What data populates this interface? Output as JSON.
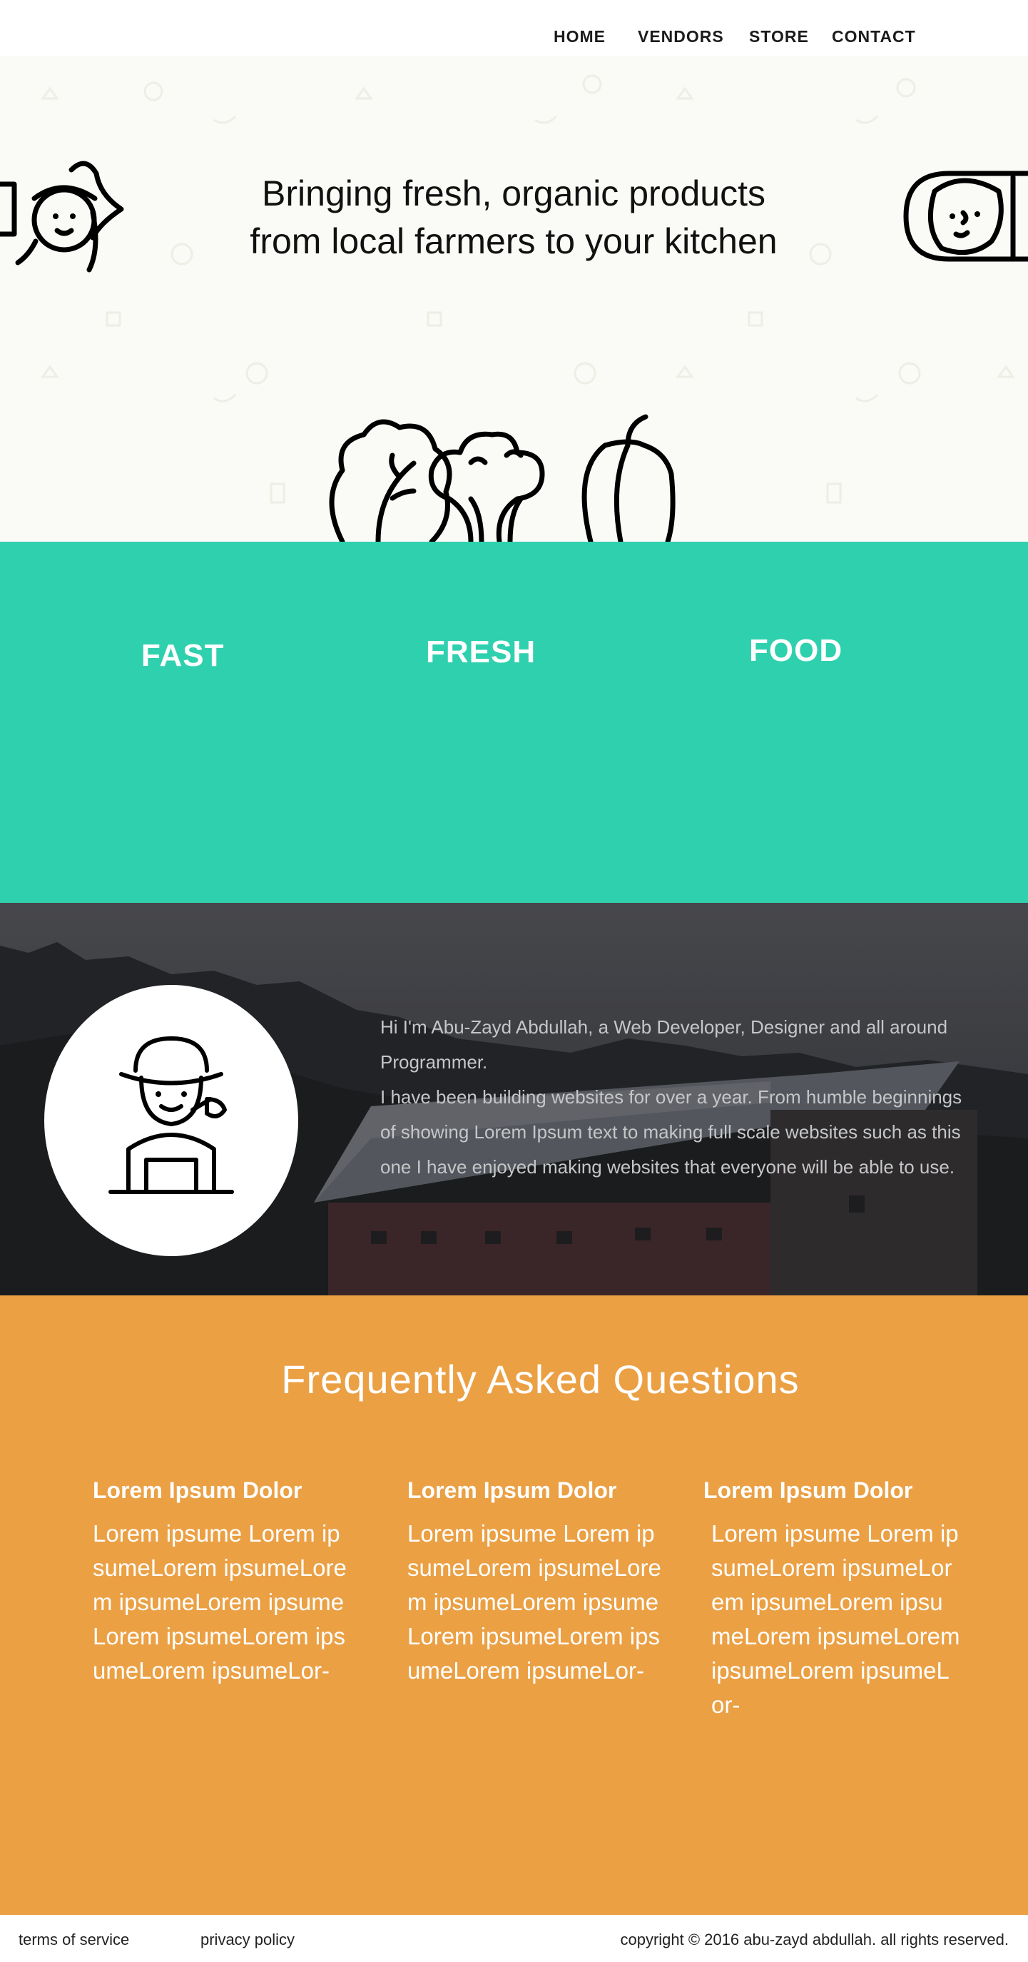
{
  "nav": {
    "items": [
      {
        "label": "HOME"
      },
      {
        "label": "VENDORS"
      },
      {
        "label": "STORE"
      },
      {
        "label": "CONTACT"
      }
    ]
  },
  "hero": {
    "title_line_1": "Bringing fresh, organic products",
    "title_line_2": "from local farmers to your kitchen",
    "icons": [
      "farmer-icon",
      "farmer-woman-icon",
      "lettuce-icon",
      "broccoli-icon",
      "pepper-icon"
    ]
  },
  "features": {
    "background_color": "#2fd0ae",
    "items": [
      {
        "label": "FAST"
      },
      {
        "label": "FRESH"
      },
      {
        "label": "FOOD"
      }
    ]
  },
  "about": {
    "avatar_icon": "farmer-icon",
    "text_line_1": "Hi I'm Abu-Zayd Abdullah, a Web Developer, Designer and all around",
    "text_line_2": "Programmer.",
    "text_line_3": "I have been building websites for over a year. From humble beginnings",
    "text_line_4": "of showing Lorem Ipsum text to making full scale websites such as this",
    "text_line_5": "one I have enjoyed making websites that everyone will be able to use."
  },
  "faq": {
    "background_color": "#eba044",
    "title": "Frequently Asked Questions",
    "items": [
      {
        "question": "Lorem Ipsum Dolor",
        "answer": "Lorem ipsume Lorem ipsumeLorem ipsumeLorem ipsumeLorem ipsumeLorem ipsumeLorem ipsumeLorem ipsumeLor-"
      },
      {
        "question": "Lorem Ipsum Dolor",
        "answer": "Lorem ipsume Lorem ipsumeLorem ipsumeLorem ipsumeLorem ipsumeLorem ipsumeLorem ipsumeLorem ipsumeLor-"
      },
      {
        "question": "Lorem Ipsum Dolor",
        "answer": "Lorem ipsume Lorem ipsumeLorem ipsumeLorem ipsumeLorem ipsumeLorem ipsumeLorem ipsumeLorem ipsumeLor-"
      }
    ]
  },
  "footer": {
    "terms": "terms of service",
    "privacy": "privacy policy",
    "copyright": "copyright © 2016 abu-zayd abdullah. all rights reserved."
  }
}
